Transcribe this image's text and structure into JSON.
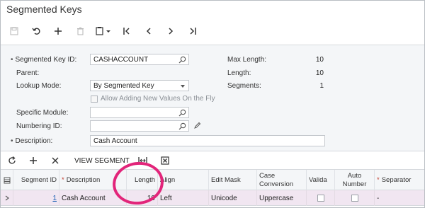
{
  "window": {
    "title": "Segmented Keys"
  },
  "toolbar": {
    "buttons": [
      "save-icon",
      "undo-icon",
      "add-icon",
      "delete-icon",
      "copy-paste-icon",
      "first-icon",
      "previous-icon",
      "next-icon",
      "last-icon"
    ]
  },
  "form": {
    "segmented_key_id": {
      "label": "Segmented Key ID:",
      "value": "CASHACCOUNT"
    },
    "parent": {
      "label": "Parent:"
    },
    "lookup_mode": {
      "label": "Lookup Mode:",
      "value": "By Segmented Key"
    },
    "allow_adding": {
      "label": "Allow Adding New Values On the Fly"
    },
    "specific_module": {
      "label": "Specific Module:",
      "value": ""
    },
    "numbering_id": {
      "label": "Numbering ID:",
      "value": ""
    },
    "description": {
      "label": "Description:",
      "value": "Cash Account"
    },
    "max_length": {
      "label": "Max Length:",
      "value": "10"
    },
    "length": {
      "label": "Length:",
      "value": "10"
    },
    "segments": {
      "label": "Segments:",
      "value": "1"
    }
  },
  "grid_toolbar": {
    "view_segment_label": "VIEW SEGMENT"
  },
  "grid": {
    "columns": {
      "segment_id": "Segment ID",
      "description": "Description",
      "length": "Length",
      "align": "Align",
      "edit_mask": "Edit Mask",
      "case_conversion": "Case Conversion",
      "validate": "Valida",
      "auto_number": "Auto Number",
      "separator": "Separator"
    },
    "rows": [
      {
        "segment_id": "1",
        "description": "Cash Account",
        "length": "10",
        "align": "Left",
        "edit_mask": "Unicode",
        "case_conversion": "Uppercase",
        "separator": "-"
      }
    ]
  },
  "colors": {
    "highlight_circle": "#e2257a",
    "selected_row": "#f1e6f1",
    "link": "#1a5fb4"
  }
}
